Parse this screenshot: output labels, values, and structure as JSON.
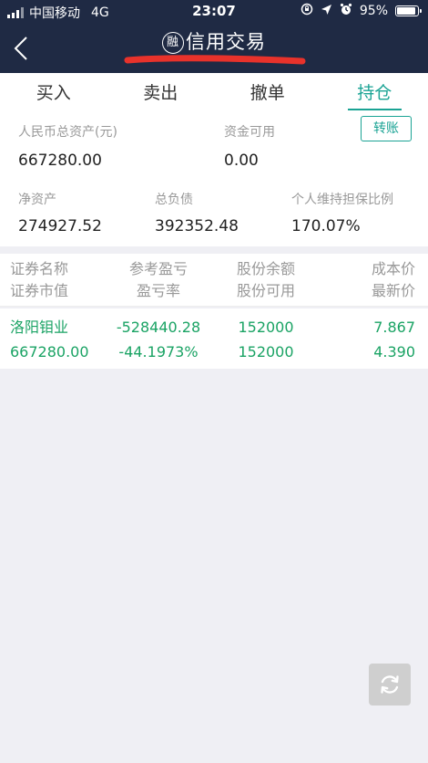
{
  "status_bar": {
    "carrier": "中国移动",
    "network": "4G",
    "time": "23:07",
    "battery": "95%",
    "battery_level": 0.95
  },
  "nav": {
    "title_badge": "融",
    "title": "信用交易"
  },
  "tabs": [
    {
      "label": "买入",
      "active": false
    },
    {
      "label": "卖出",
      "active": false
    },
    {
      "label": "撤单",
      "active": false
    },
    {
      "label": "持仓",
      "active": true
    }
  ],
  "summary": {
    "total_assets_label": "人民币总资产(元)",
    "total_assets_value": "667280.00",
    "available_funds_label": "资金可用",
    "available_funds_value": "0.00",
    "transfer_label": "转账",
    "net_assets_label": "净资产",
    "net_assets_value": "274927.52",
    "total_liabilities_label": "总负债",
    "total_liabilities_value": "392352.48",
    "maintenance_ratio_label": "个人维持担保比例",
    "maintenance_ratio_value": "170.07%"
  },
  "holdings": {
    "headers": [
      {
        "top": "证券名称",
        "bottom": "证券市值"
      },
      {
        "top": "参考盈亏",
        "bottom": "盈亏率"
      },
      {
        "top": "股份余额",
        "bottom": "股份可用"
      },
      {
        "top": "成本价",
        "bottom": "最新价"
      }
    ],
    "rows": [
      {
        "name": "洛阳钼业",
        "market_value": "667280.00",
        "pnl": "-528440.28",
        "pnl_rate": "-44.1973%",
        "balance": "152000",
        "available": "152000",
        "cost_price": "7.867",
        "latest_price": "4.390"
      }
    ]
  },
  "colors": {
    "header_bg": "#1f2a44",
    "accent": "#1aa394",
    "gain_loss_text": "#1aa364",
    "redaction": "#e8322b"
  }
}
